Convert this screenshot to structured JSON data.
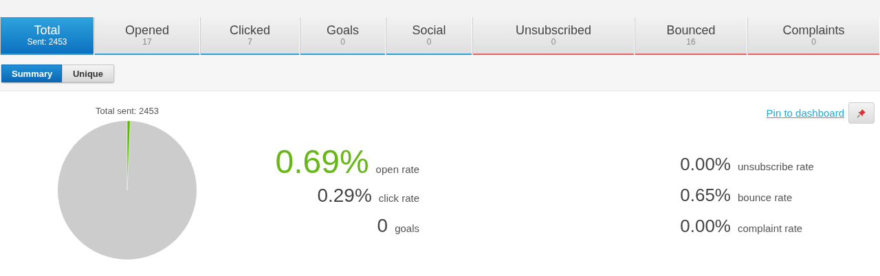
{
  "tabs": [
    {
      "label": "Total",
      "count": "Sent: 2453",
      "selected": true,
      "color": "#2a9fd8"
    },
    {
      "label": "Opened",
      "count": "17",
      "selected": false,
      "color": "#2a9fd8"
    },
    {
      "label": "Clicked",
      "count": "7",
      "selected": false,
      "color": "#2a9fd8"
    },
    {
      "label": "Goals",
      "count": "0",
      "selected": false,
      "color": "#2a9fd8"
    },
    {
      "label": "Social",
      "count": "0",
      "selected": false,
      "color": "#2a9fd8"
    },
    {
      "label": "Unsubscribed",
      "count": "0",
      "selected": false,
      "color": "#e86060"
    },
    {
      "label": "Bounced",
      "count": "16",
      "selected": false,
      "color": "#e86060"
    },
    {
      "label": "Complaints",
      "count": "0",
      "selected": false,
      "color": "#e86060"
    }
  ],
  "view_toggle": [
    {
      "label": "Summary",
      "selected": true
    },
    {
      "label": "Unique",
      "selected": false
    }
  ],
  "pie_title": "Total sent: 2453",
  "pin_link": "Pin to dashboard",
  "stats_left": [
    {
      "value": "0.69%",
      "label": "open rate",
      "kind": "highlight"
    },
    {
      "value": "0.29%",
      "label": "click rate",
      "kind": "normal"
    },
    {
      "value": "0",
      "label": "goals",
      "kind": "normal"
    }
  ],
  "stats_right": [
    {
      "value": "0.00%",
      "label": "unsubscribe rate"
    },
    {
      "value": "0.65%",
      "label": "bounce rate"
    },
    {
      "value": "0.00%",
      "label": "complaint rate"
    }
  ]
}
